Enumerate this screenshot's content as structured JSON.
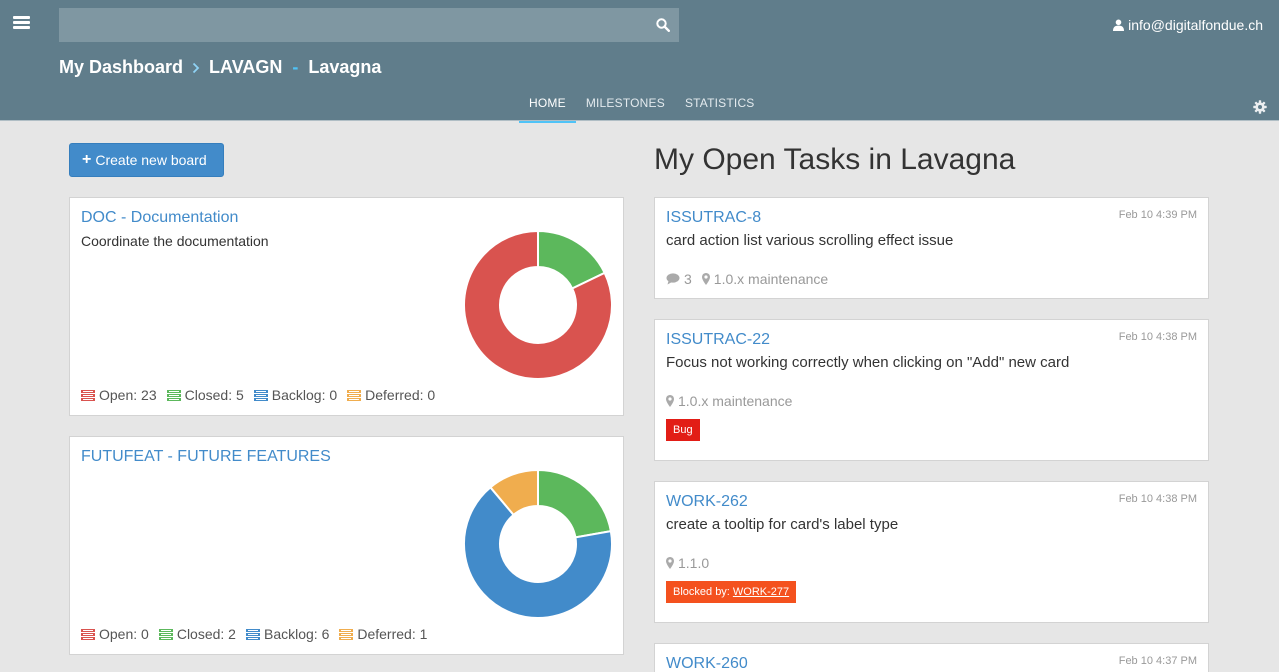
{
  "header": {
    "search_placeholder": "",
    "user_email": "info@digitalfondue.ch",
    "breadcrumb": {
      "dashboard": "My Dashboard",
      "project_key": "LAVAGN",
      "project_name": "Lavagna"
    },
    "tabs": [
      {
        "label": "HOME",
        "active": true
      },
      {
        "label": "MILESTONES",
        "active": false
      },
      {
        "label": "STATISTICS",
        "active": false
      }
    ]
  },
  "colors": {
    "header_bg": "#607d8b",
    "accent": "#4fc3f7",
    "link": "#428bca",
    "open": "#d9534f",
    "closed": "#5cb85c",
    "backlog": "#428bca",
    "deferred": "#f0ad4e"
  },
  "create_board_label": "Create new board",
  "boards": [
    {
      "title": "DOC - Documentation",
      "description": "Coordinate the documentation",
      "stats": {
        "open_label": "Open: 23",
        "closed_label": "Closed: 5",
        "backlog_label": "Backlog: 0",
        "deferred_label": "Deferred: 0"
      },
      "counts": {
        "open": 23,
        "closed": 5,
        "backlog": 0,
        "deferred": 0
      }
    },
    {
      "title": "FUTUFEAT - FUTURE FEATURES",
      "description": "",
      "stats": {
        "open_label": "Open: 0",
        "closed_label": "Closed: 2",
        "backlog_label": "Backlog: 6",
        "deferred_label": "Deferred: 1"
      },
      "counts": {
        "open": 0,
        "closed": 2,
        "backlog": 6,
        "deferred": 1
      }
    }
  ],
  "tasks_title": "My Open Tasks in Lavagna",
  "tasks": [
    {
      "id": "ISSUTRAC-8",
      "date": "Feb 10 4:39 PM",
      "name": "card action list various scrolling effect issue",
      "comments": "3",
      "milestone": "1.0.x maintenance"
    },
    {
      "id": "ISSUTRAC-22",
      "date": "Feb 10 4:38 PM",
      "name": "Focus not working correctly when clicking on \"Add\" new card",
      "milestone": "1.0.x maintenance",
      "label": "Bug"
    },
    {
      "id": "WORK-262",
      "date": "Feb 10 4:38 PM",
      "name": "create a tooltip for card's label type",
      "milestone": "1.1.0",
      "blocked_prefix": "Blocked by:",
      "blocked_by": "WORK-277"
    },
    {
      "id": "WORK-260",
      "date": "Feb 10 4:37 PM"
    }
  ]
}
